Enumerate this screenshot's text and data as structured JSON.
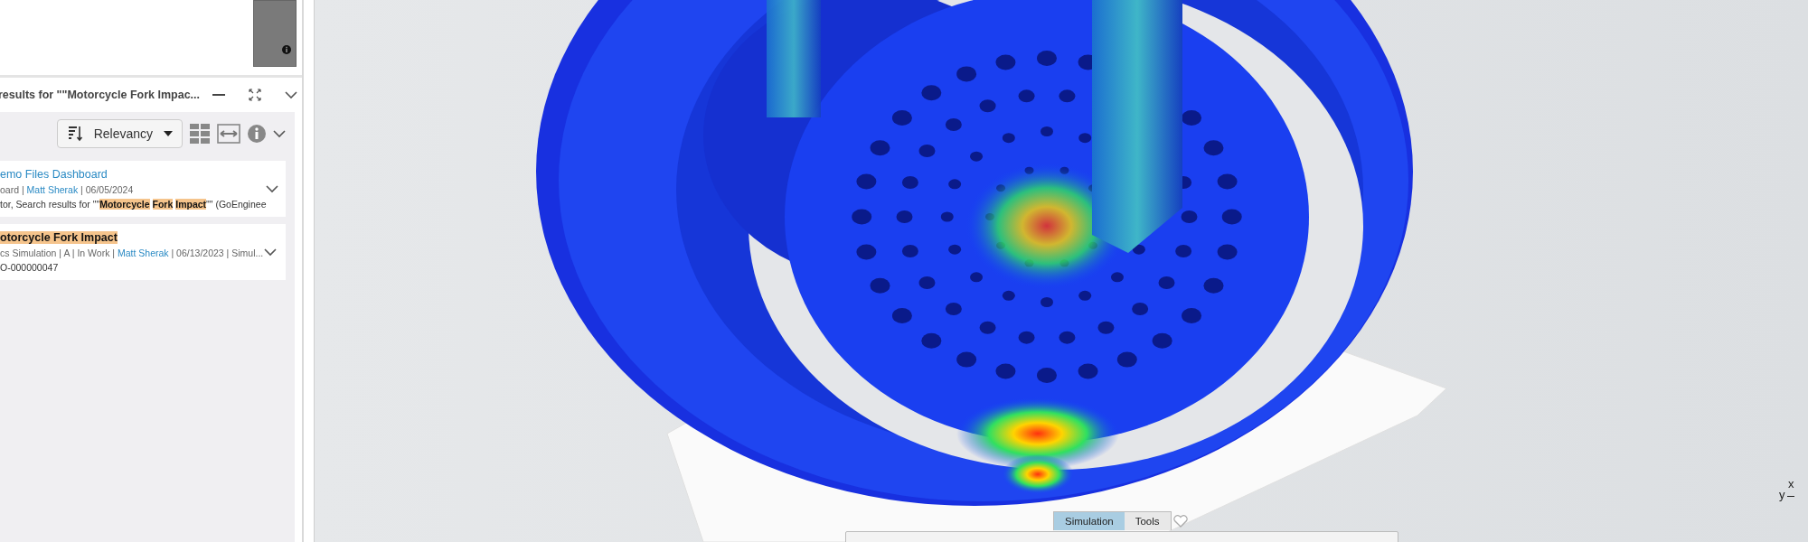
{
  "panel": {
    "title": "results for \"\"Motorcycle Fork Impac...",
    "sort": {
      "label": "Relevancy"
    },
    "results": [
      {
        "title": "emo Files Dashboard",
        "highlighted": false,
        "meta": [
          {
            "kind": "text",
            "text": "oard | "
          },
          {
            "kind": "link",
            "text": "Matt Sherak"
          },
          {
            "kind": "text",
            "text": " | 06/05/2024"
          }
        ],
        "snippet": "tor, Search results for \"\"**Motorcycle** **Fork** **Impact**\"\" (GoEnginee"
      },
      {
        "title": "otorcycle Fork Impact",
        "highlighted": true,
        "meta": [
          {
            "kind": "text",
            "text": "cs Simulation | A | In Work | "
          },
          {
            "kind": "link",
            "text": "Matt Sherak"
          },
          {
            "kind": "text",
            "text": " | 06/13/2023 | Simul..."
          }
        ],
        "snippet": "O-000000047"
      }
    ]
  },
  "viewport": {
    "tabs": [
      {
        "label": "Simulation",
        "selected": true
      },
      {
        "label": "Tools",
        "selected": false
      }
    ],
    "triad": {
      "x": "x",
      "y": "y"
    }
  }
}
